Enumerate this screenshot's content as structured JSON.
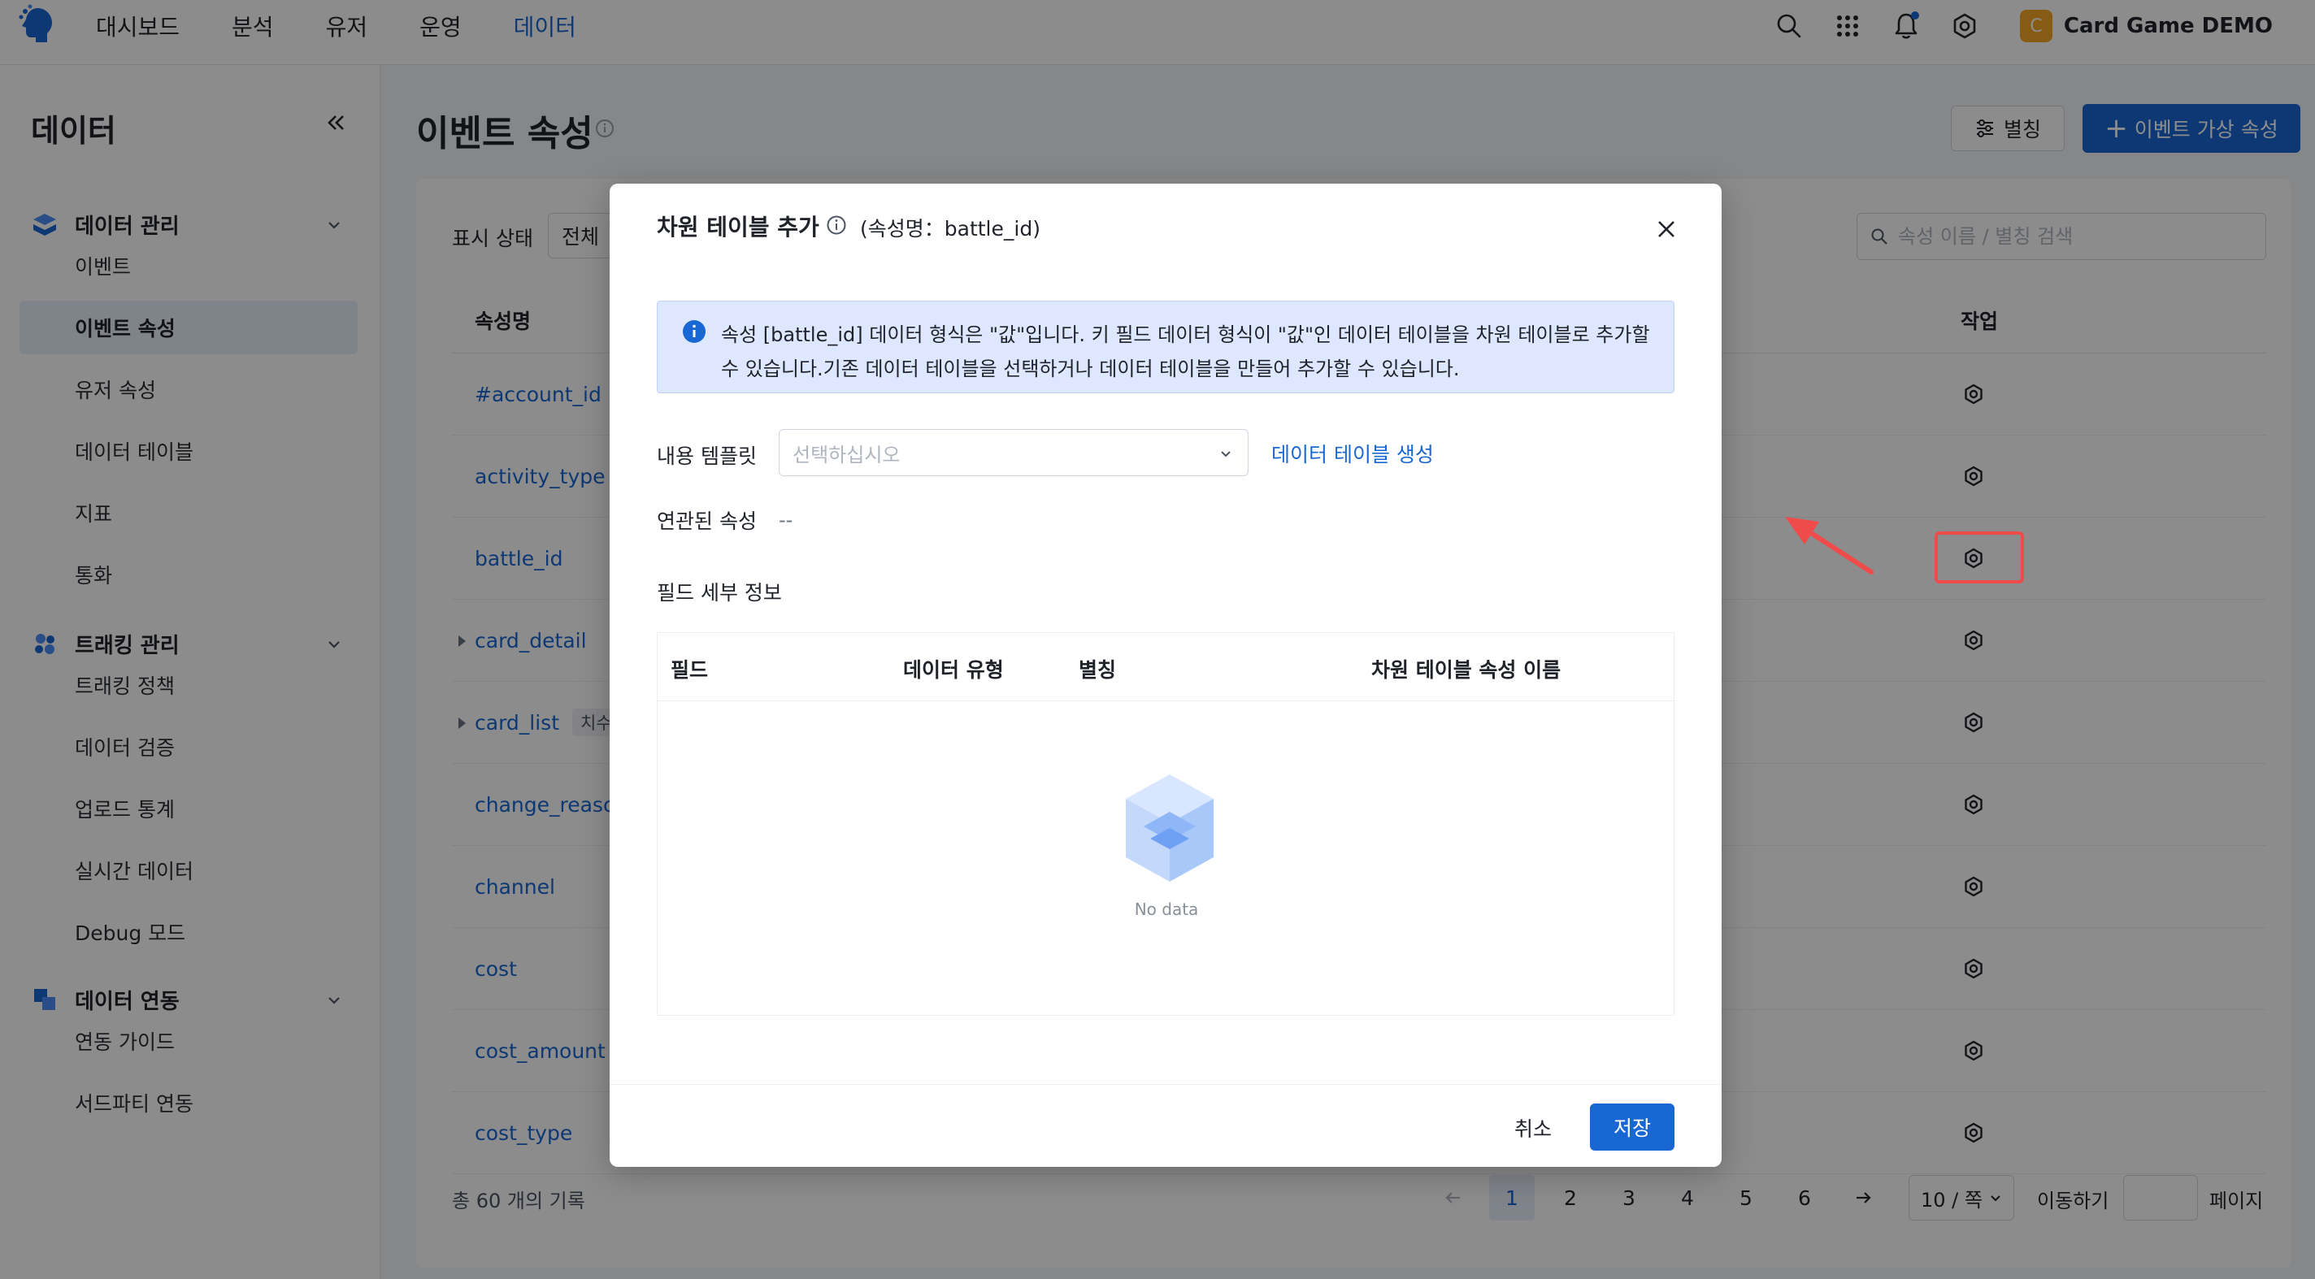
{
  "topnav": {
    "items": [
      "대시보드",
      "분석",
      "유저",
      "운영",
      "데이터"
    ],
    "active_index": 4,
    "accent_color": "#1967d2"
  },
  "header_right": {
    "icons": [
      "search-icon",
      "apps-grid-icon",
      "bell-icon",
      "gear-icon"
    ],
    "project_badge": "C",
    "project_name": "Card Game DEMO"
  },
  "sidebar": {
    "title": "데이터",
    "groups": [
      {
        "label": "데이터 관리",
        "icon": "data-management-icon",
        "items": [
          "이벤트",
          "이벤트 속성",
          "유저 속성",
          "데이터 테이블",
          "지표",
          "통화"
        ]
      },
      {
        "label": "트래킹 관리",
        "icon": "tracking-icon",
        "items": [
          "트래킹 정책",
          "데이터 검증",
          "업로드 통계",
          "실시간 데이터",
          "Debug 모드"
        ]
      },
      {
        "label": "데이터 연동",
        "icon": "data-integration-icon",
        "items": [
          "연동 가이드",
          "서드파티 연동"
        ]
      }
    ],
    "active_item": "이벤트 속성"
  },
  "main": {
    "title": "이벤트 속성",
    "alias_button": "별칭",
    "add_virtual_button": "이벤트 가상 속성",
    "filter_label": "표시 상태",
    "filter_value": "전체",
    "search_placeholder": "속성 이름 / 별칭 검색",
    "columns": {
      "name": "속성명",
      "action": "작업"
    },
    "rows": [
      {
        "name": "#account_id",
        "expandable": false,
        "tag": ""
      },
      {
        "name": "activity_type",
        "expandable": false,
        "tag": ""
      },
      {
        "name": "battle_id",
        "expandable": false,
        "tag": ""
      },
      {
        "name": "card_detail",
        "expandable": true,
        "tag": ""
      },
      {
        "name": "card_list",
        "expandable": true,
        "tag": "치수표"
      },
      {
        "name": "change_reason",
        "expandable": false,
        "tag": ""
      },
      {
        "name": "channel",
        "expandable": false,
        "tag": ""
      },
      {
        "name": "cost",
        "expandable": false,
        "tag": ""
      },
      {
        "name": "cost_amount",
        "expandable": false,
        "tag": ""
      },
      {
        "name": "cost_type",
        "expandable": false,
        "tag": ""
      }
    ],
    "highlighted_row_index": 2,
    "annotation_color": "#f04b4b",
    "total_text": "총 60 개의 기록",
    "pagination": {
      "pages": [
        "1",
        "2",
        "3",
        "4",
        "5",
        "6"
      ],
      "current": "1",
      "page_size": "10 / 쪽",
      "goto_label": "이동하기",
      "page_suffix": "페이지"
    }
  },
  "modal": {
    "title": "차원 테이블 추가",
    "subtitle": "(속성명：battle_id)",
    "alert": "속성 [battle_id] 데이터 형식은 \"값\"입니다. 키 필드 데이터 형식이 \"값\"인 데이터 테이블을 차원 테이블로 추가할 수 있습니다.기존 데이터 테이블을 선택하거나 데이터 테이블을 만들어 추가할 수 있습니다.",
    "template_label": "내용 템플릿",
    "template_placeholder": "선택하십시오",
    "create_table_link": "데이터 테이블 생성",
    "related_label": "연관된 속성",
    "related_value": "--",
    "field_detail_label": "필드 세부 정보",
    "table_columns": [
      "필드",
      "데이터 유형",
      "별칭",
      "차원 테이블 속성 이름"
    ],
    "empty_text": "No data",
    "cancel_label": "취소",
    "save_label": "저장"
  }
}
